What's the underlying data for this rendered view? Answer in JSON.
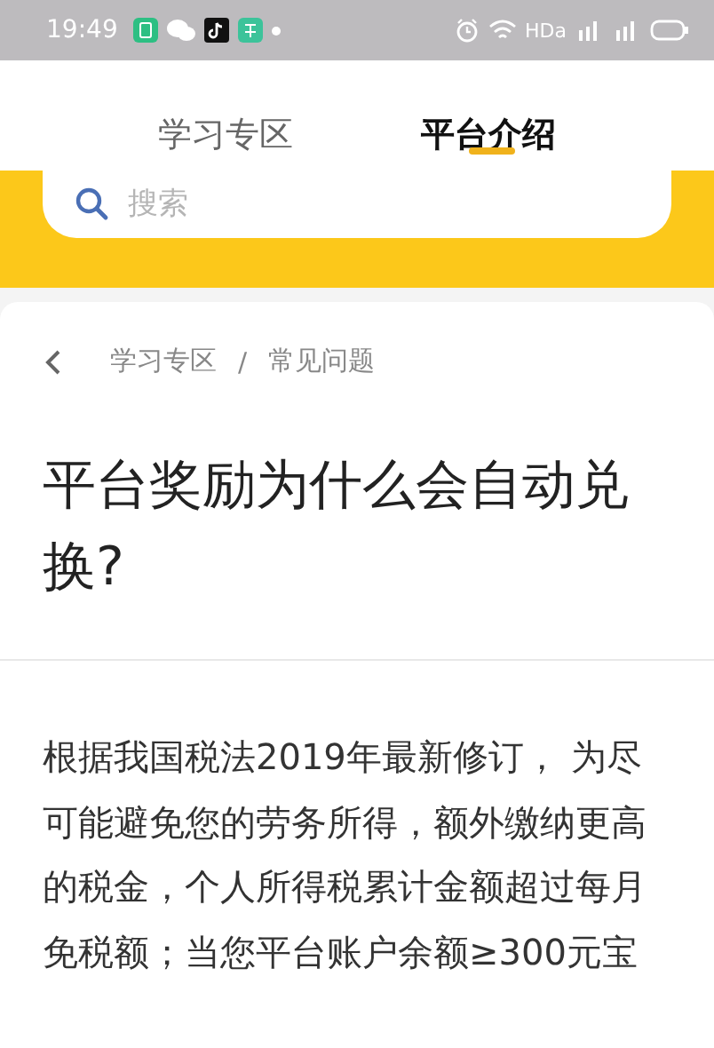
{
  "status_bar": {
    "time": "19:49",
    "network_label": "HDa"
  },
  "tabs": [
    {
      "label": "学习专区",
      "selected": false
    },
    {
      "label": "平台介绍",
      "selected": true
    }
  ],
  "search": {
    "placeholder": "搜索"
  },
  "breadcrumb": [
    "学习专区",
    "常见问题"
  ],
  "breadcrumb_separator": "/",
  "title": "平台奖励为什么会自动兑换?",
  "body": "根据我国税法2019年最新修订， 为尽可能避免您的劳务所得，额外缴纳更高的税金，个人所得税累计金额超过每月免税额；当您平台账户余额≥300元宝"
}
